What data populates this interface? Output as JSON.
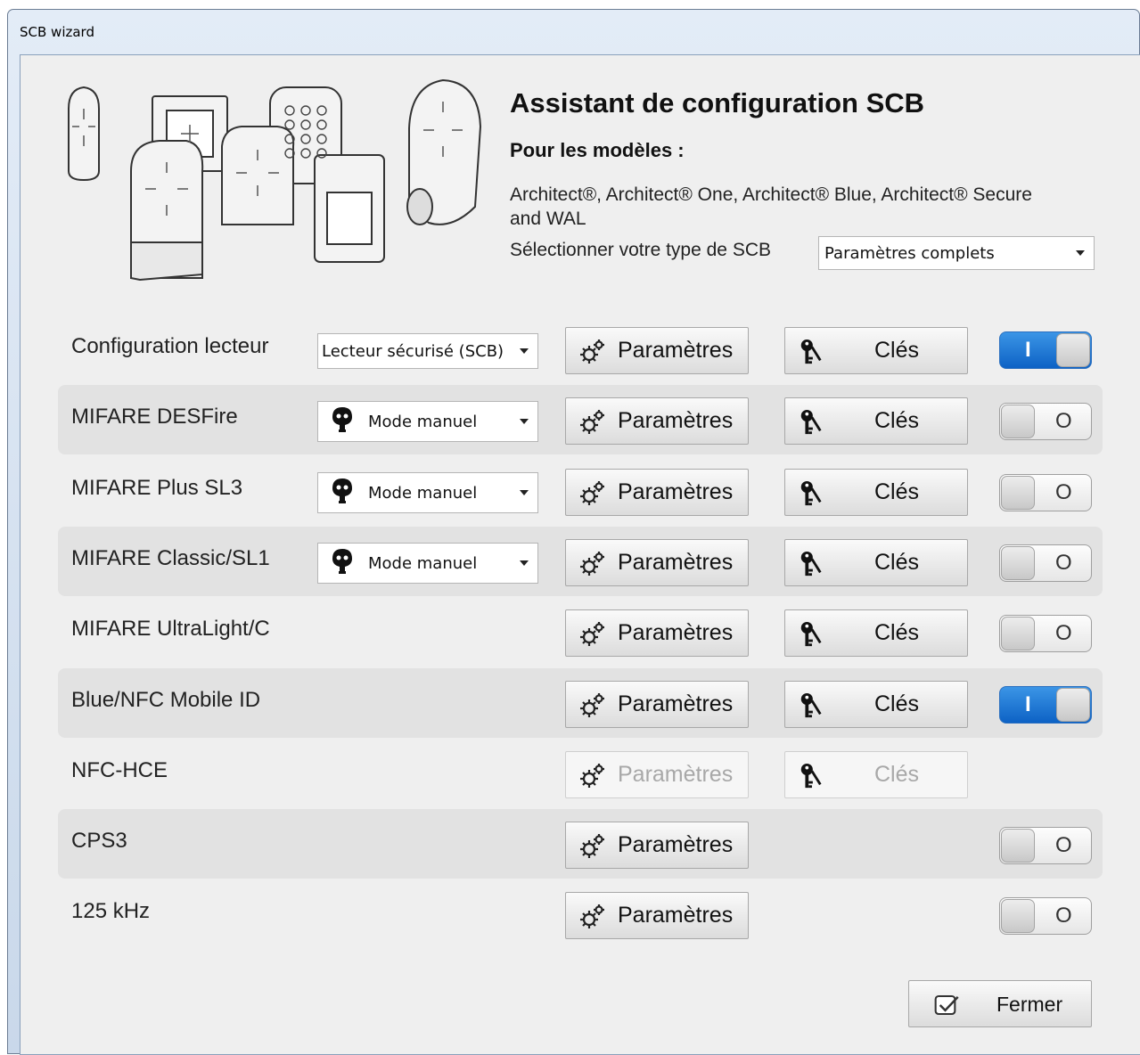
{
  "window": {
    "title": "SCB wizard"
  },
  "header": {
    "title": "Assistant de configuration SCB",
    "subtitle": "Pour les modèles :",
    "models": "Architect®, Architect® One, Architect® Blue, Architect® Secure and WAL",
    "scb_type_label": "Sélectionner votre type de SCB",
    "scb_type_value": "Paramètres complets"
  },
  "reader": {
    "mode_value": "Lecteur sécurisé (SCB)"
  },
  "buttons": {
    "params": "Paramètres",
    "keys": "Clés",
    "close": "Fermer"
  },
  "rows": [
    {
      "label": "Configuration lecteur",
      "mode": "",
      "toggle": "on",
      "toggle_text": "I"
    },
    {
      "label": "MIFARE DESFire",
      "mode": "Mode manuel",
      "toggle": "off",
      "toggle_text": "O"
    },
    {
      "label": "MIFARE Plus SL3",
      "mode": "Mode manuel",
      "toggle": "off",
      "toggle_text": "O"
    },
    {
      "label": "MIFARE Classic/SL1",
      "mode": "Mode manuel",
      "toggle": "off",
      "toggle_text": "O"
    },
    {
      "label": "MIFARE UltraLight/C",
      "mode": "",
      "toggle": "off",
      "toggle_text": "O"
    },
    {
      "label": "Blue/NFC Mobile ID",
      "mode": "",
      "toggle": "on",
      "toggle_text": "I"
    },
    {
      "label": "NFC-HCE",
      "mode": "",
      "toggle": "",
      "toggle_text": ""
    },
    {
      "label": "CPS3",
      "mode": "",
      "toggle": "off",
      "toggle_text": "O"
    },
    {
      "label": "125 kHz",
      "mode": "",
      "toggle": "off",
      "toggle_text": "O"
    }
  ],
  "colors": {
    "toggle_on": "#1a73d4",
    "client_bg": "#efefef",
    "row_shade": "#e2e2e2"
  }
}
